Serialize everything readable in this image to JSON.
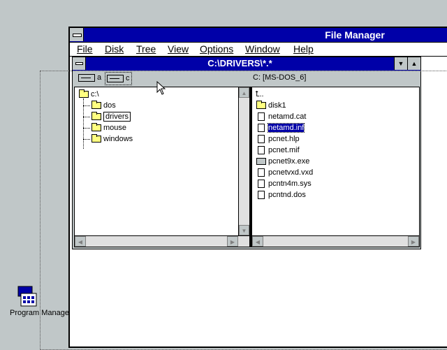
{
  "desktop": {
    "program_manager_label": "Program Manage"
  },
  "window": {
    "title": "File Manager",
    "menu": [
      "File",
      "Disk",
      "Tree",
      "View",
      "Options",
      "Window",
      "Help"
    ]
  },
  "child": {
    "title": "C:\\DRIVERS\\*.*",
    "drives": [
      "a",
      "c"
    ],
    "volume_label": "C: [MS-DOS_6]"
  },
  "tree": {
    "root": "c:\\",
    "folders": [
      "dos",
      "drivers",
      "mouse",
      "windows"
    ],
    "selected": "drivers"
  },
  "files": {
    "up": "..",
    "items": [
      {
        "name": "disk1",
        "type": "folder"
      },
      {
        "name": "netamd.cat",
        "type": "doc"
      },
      {
        "name": "netamd.inf",
        "type": "doc",
        "selected": true
      },
      {
        "name": "pcnet.hlp",
        "type": "doc"
      },
      {
        "name": "pcnet.mif",
        "type": "doc"
      },
      {
        "name": "pcnet9x.exe",
        "type": "exe"
      },
      {
        "name": "pcnetvxd.vxd",
        "type": "doc"
      },
      {
        "name": "pcntn4m.sys",
        "type": "doc"
      },
      {
        "name": "pcntnd.dos",
        "type": "doc"
      }
    ]
  },
  "colors": {
    "desktop": "#c0c7c8",
    "titlebar": "#0000a8",
    "selection": "#0000a8",
    "folder": "#ffff80"
  }
}
